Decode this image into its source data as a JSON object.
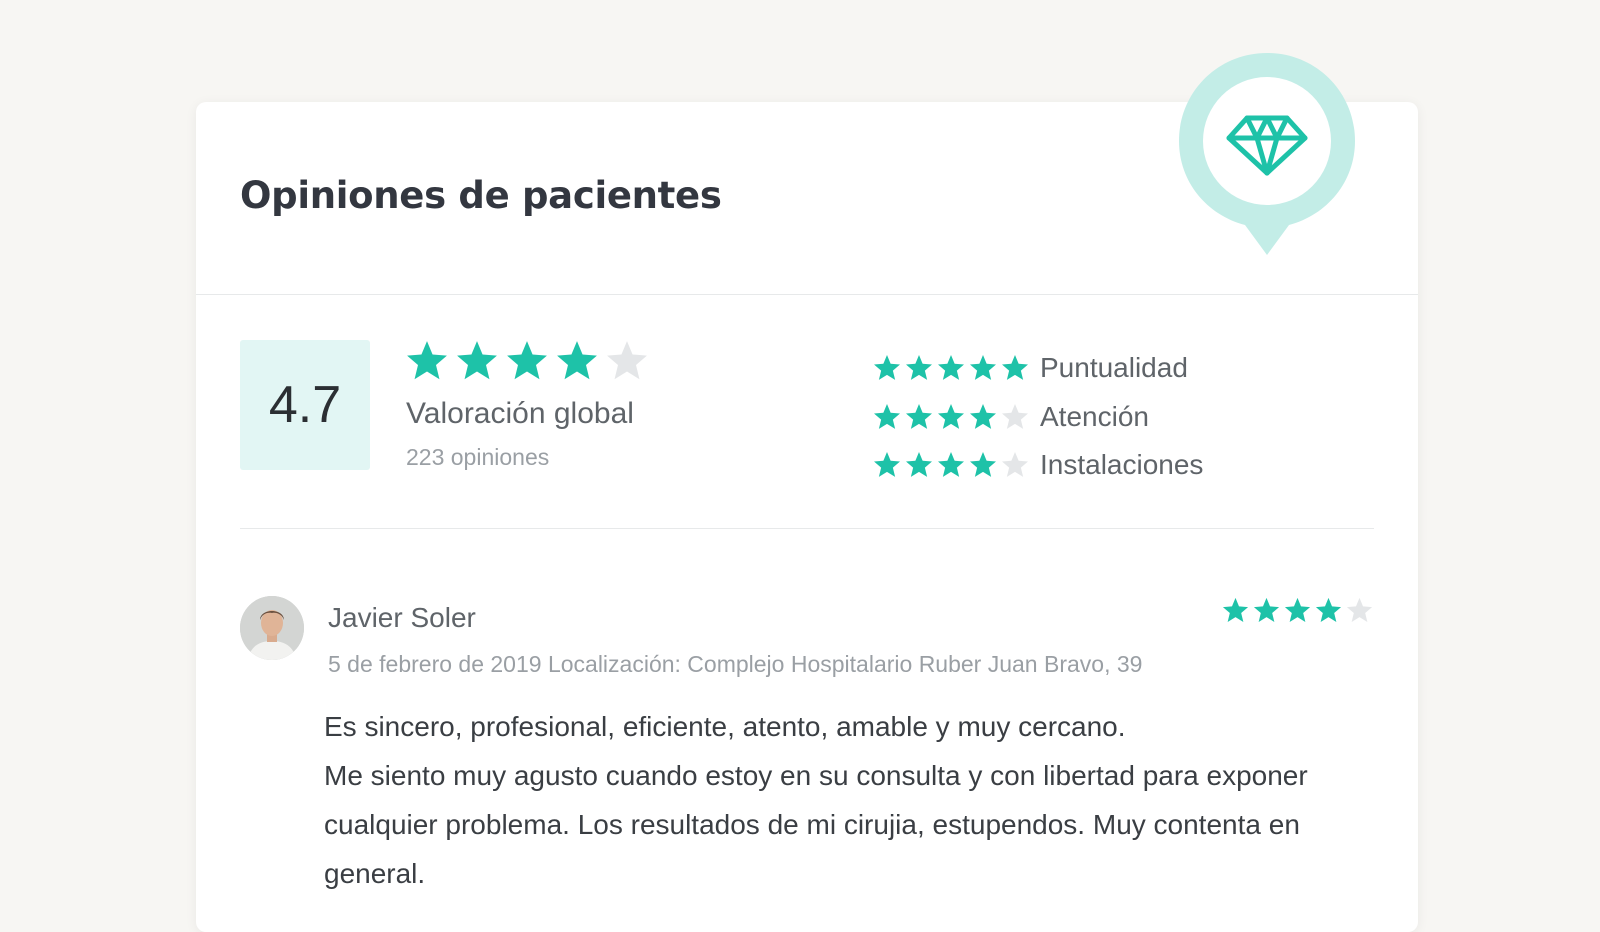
{
  "colors": {
    "accent": "#1ec2a8",
    "star_empty": "#e4e6e8",
    "pin_ring": "#c3ede7"
  },
  "header": {
    "title": "Opiniones de pacientes",
    "badge_icon": "diamond-icon"
  },
  "summary": {
    "score": "4.7",
    "stars": 4,
    "max_stars": 5,
    "label": "Valoración global",
    "count_text": "223 opiniones"
  },
  "categories": [
    {
      "label": "Puntualidad",
      "stars": 5
    },
    {
      "label": "Atención",
      "stars": 4
    },
    {
      "label": "Instalaciones",
      "stars": 4
    }
  ],
  "review": {
    "name": "Javier Soler",
    "meta": "5 de febrero de 2019 Localización: Complejo Hospitalario Ruber Juan Bravo, 39",
    "stars": 4,
    "avatar_icon": "avatar",
    "text_lines": [
      "Es sincero, profesional, eficiente, atento, amable y muy cercano.",
      "Me siento muy agusto cuando estoy en su consulta y con libertad para exponer cualquier problema. Los resultados de mi cirujia, estupendos. Muy contenta en general."
    ]
  }
}
